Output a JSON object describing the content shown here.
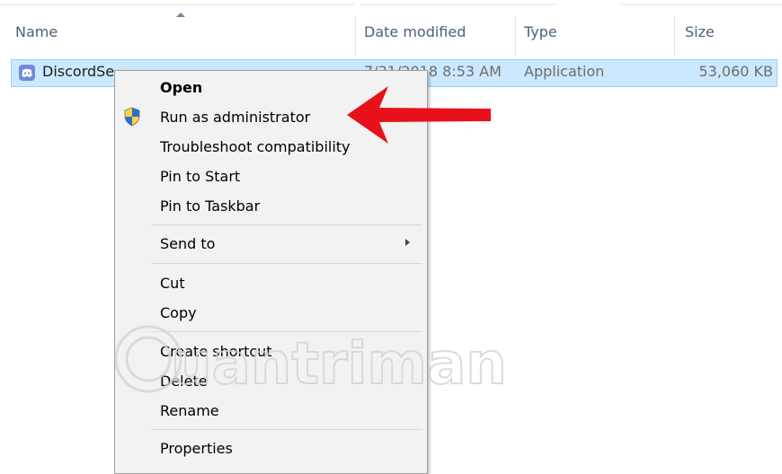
{
  "columns": {
    "name": "Name",
    "date_modified": "Date modified",
    "type": "Type",
    "size": "Size"
  },
  "file": {
    "name": "DiscordSe",
    "date": "7/31/2018 8:53 AM",
    "type": "Application",
    "size": "53,060 KB",
    "icon": "discord-icon"
  },
  "context_menu": {
    "open": "Open",
    "run_as_admin": "Run as administrator",
    "troubleshoot": "Troubleshoot compatibility",
    "pin_start": "Pin to Start",
    "pin_taskbar": "Pin to Taskbar",
    "send_to": "Send to",
    "cut": "Cut",
    "copy": "Copy",
    "create_shortcut": "Create shortcut",
    "delete": "Delete",
    "rename": "Rename",
    "properties": "Properties"
  },
  "watermark": {
    "text": "uantrimang"
  },
  "colors": {
    "selection": "#cce8ff",
    "selection_border": "#99d1ff",
    "arrow": "#e8111b",
    "discord": "#7289da"
  }
}
